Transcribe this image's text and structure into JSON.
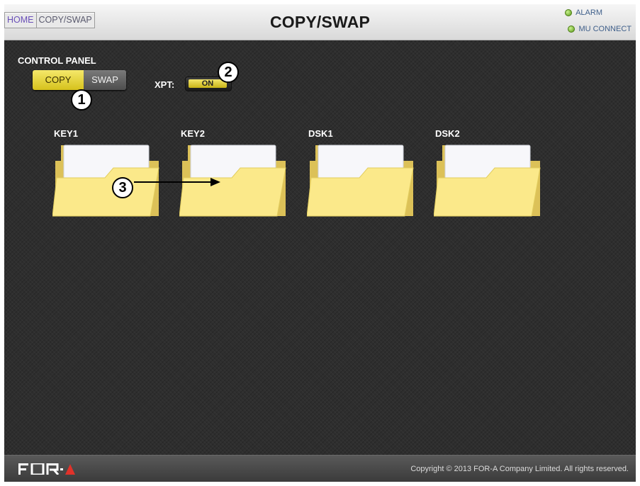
{
  "header": {
    "breadcrumb": [
      {
        "label": "HOME"
      },
      {
        "label": "COPY/SWAP"
      }
    ],
    "title": "COPY/SWAP",
    "status": {
      "alarm_label": "ALARM",
      "mu_connect_label": "MU CONNECT",
      "led_color": "#6ab023"
    }
  },
  "control_panel": {
    "label": "CONTROL PANEL",
    "copy_label": "COPY",
    "swap_label": "SWAP",
    "selected": "COPY",
    "xpt_label": "XPT:",
    "xpt_button_label": "ON"
  },
  "callouts": {
    "c1": "1",
    "c2": "2",
    "c3": "3"
  },
  "folders": [
    {
      "label": "KEY1"
    },
    {
      "label": "KEY2"
    },
    {
      "label": "DSK1"
    },
    {
      "label": "DSK2"
    }
  ],
  "footer": {
    "logo_text": "FOR-A",
    "copyright": "Copyright © 2013 FOR-A Company Limited. All rights reserved."
  },
  "colors": {
    "accent_yellow": "#e8d63a",
    "folder_yellow": "#fbe98a",
    "background": "#2e2e2e"
  }
}
